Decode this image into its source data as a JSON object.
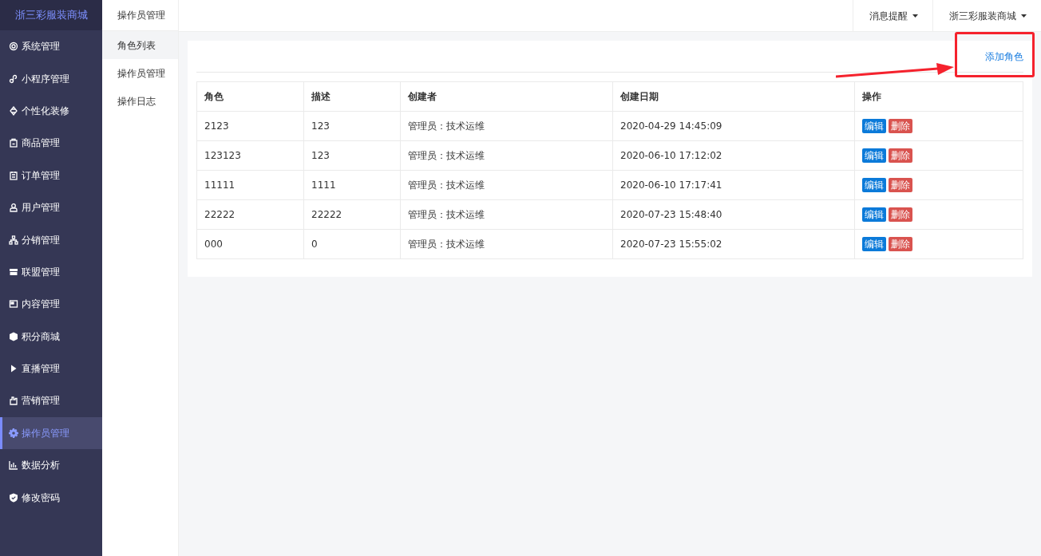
{
  "brand": "浙三彩服装商城",
  "sidebar": {
    "items": [
      {
        "label": "系统管理",
        "selected": false
      },
      {
        "label": "小程序管理",
        "selected": false
      },
      {
        "label": "个性化装修",
        "selected": false
      },
      {
        "label": "商品管理",
        "selected": false
      },
      {
        "label": "订单管理",
        "selected": false
      },
      {
        "label": "用户管理",
        "selected": false
      },
      {
        "label": "分销管理",
        "selected": false
      },
      {
        "label": "联盟管理",
        "selected": false
      },
      {
        "label": "内容管理",
        "selected": false
      },
      {
        "label": "积分商城",
        "selected": false
      },
      {
        "label": "直播管理",
        "selected": false
      },
      {
        "label": "营销管理",
        "selected": false
      },
      {
        "label": "操作员管理",
        "selected": true
      },
      {
        "label": "数据分析",
        "selected": false
      },
      {
        "label": "修改密码",
        "selected": false
      }
    ]
  },
  "submenu": {
    "title": "操作员管理",
    "items": [
      {
        "label": "角色列表",
        "selected": true
      },
      {
        "label": "操作员管理",
        "selected": false
      },
      {
        "label": "操作日志",
        "selected": false
      }
    ]
  },
  "topbar": {
    "menus": [
      "消息提醒",
      "浙三彩服装商城"
    ]
  },
  "add_link": "添加角色",
  "table": {
    "columns": [
      "角色",
      "描述",
      "创建者",
      "创建日期",
      "操作"
    ],
    "rows": [
      {
        "cells": [
          "2123",
          "123",
          "管理员：技术运维",
          "2020-04-29 14:45:09"
        ],
        "actions": [
          "编辑",
          "删除"
        ]
      },
      {
        "cells": [
          "123123",
          "123",
          "管理员：技术运维",
          "2020-06-10 17:12:02"
        ],
        "actions": [
          "编辑",
          "删除"
        ]
      },
      {
        "cells": [
          "11111",
          "1111",
          "管理员：技术运维",
          "2020-06-10 17:17:41"
        ],
        "actions": [
          "编辑",
          "删除"
        ]
      },
      {
        "cells": [
          "22222",
          "22222",
          "管理员：技术运维",
          "2020-07-23 15:48:40"
        ],
        "actions": [
          "编辑",
          "删除"
        ]
      },
      {
        "cells": [
          "000",
          "0",
          "管理员：技术运维",
          "2020-07-23 15:55:02"
        ],
        "actions": [
          "编辑",
          "删除"
        ]
      }
    ]
  },
  "callout": {
    "box": true,
    "arrow": true
  }
}
